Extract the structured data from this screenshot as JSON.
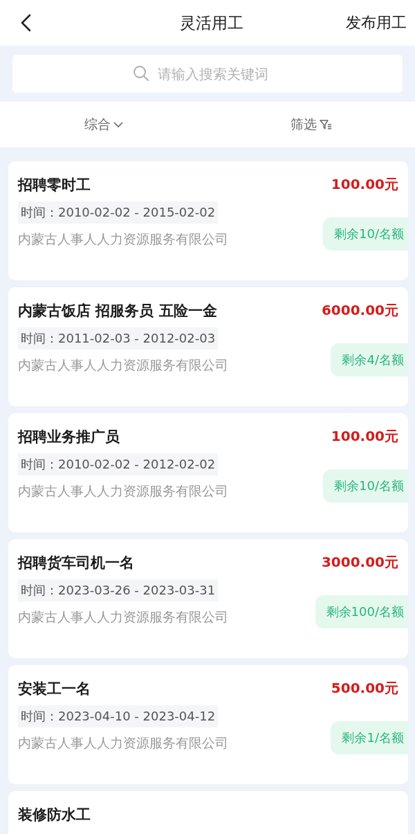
{
  "header": {
    "title": "灵活用工",
    "action": "发布用工"
  },
  "search": {
    "placeholder": "请输入搜索关键词"
  },
  "sort_bar": {
    "sort": "综合",
    "filter": "筛选"
  },
  "jobs": [
    {
      "title": "招聘零时工",
      "price": "100.00元",
      "time_label": "时间：",
      "time": "2010-02-02 - 2015-02-02",
      "company": "内蒙古人事人人力资源服务有限公司",
      "quota": "剩余10/名额"
    },
    {
      "title": "内蒙古饭店 招服务员 五险一金",
      "price": "6000.00元",
      "time_label": "时间：",
      "time": "2011-02-03 - 2012-02-03",
      "company": "内蒙古人事人人力资源服务有限公司",
      "quota": "剩余4/名额"
    },
    {
      "title": "招聘业务推广员",
      "price": "100.00元",
      "time_label": "时间：",
      "time": "2010-02-02 - 2012-02-02",
      "company": "内蒙古人事人人力资源服务有限公司",
      "quota": "剩余10/名额"
    },
    {
      "title": "招聘货车司机一名",
      "price": "3000.00元",
      "time_label": "时间：",
      "time": "2023-03-26 - 2023-03-31",
      "company": "内蒙古人事人人力资源服务有限公司",
      "quota": "剩余100/名额"
    },
    {
      "title": "安装工一名",
      "price": "500.00元",
      "time_label": "时间：",
      "time": "2023-04-10 - 2023-04-12",
      "company": "内蒙古人事人人力资源服务有限公司",
      "quota": "剩余1/名额"
    },
    {
      "title": "装修防水工"
    }
  ]
}
